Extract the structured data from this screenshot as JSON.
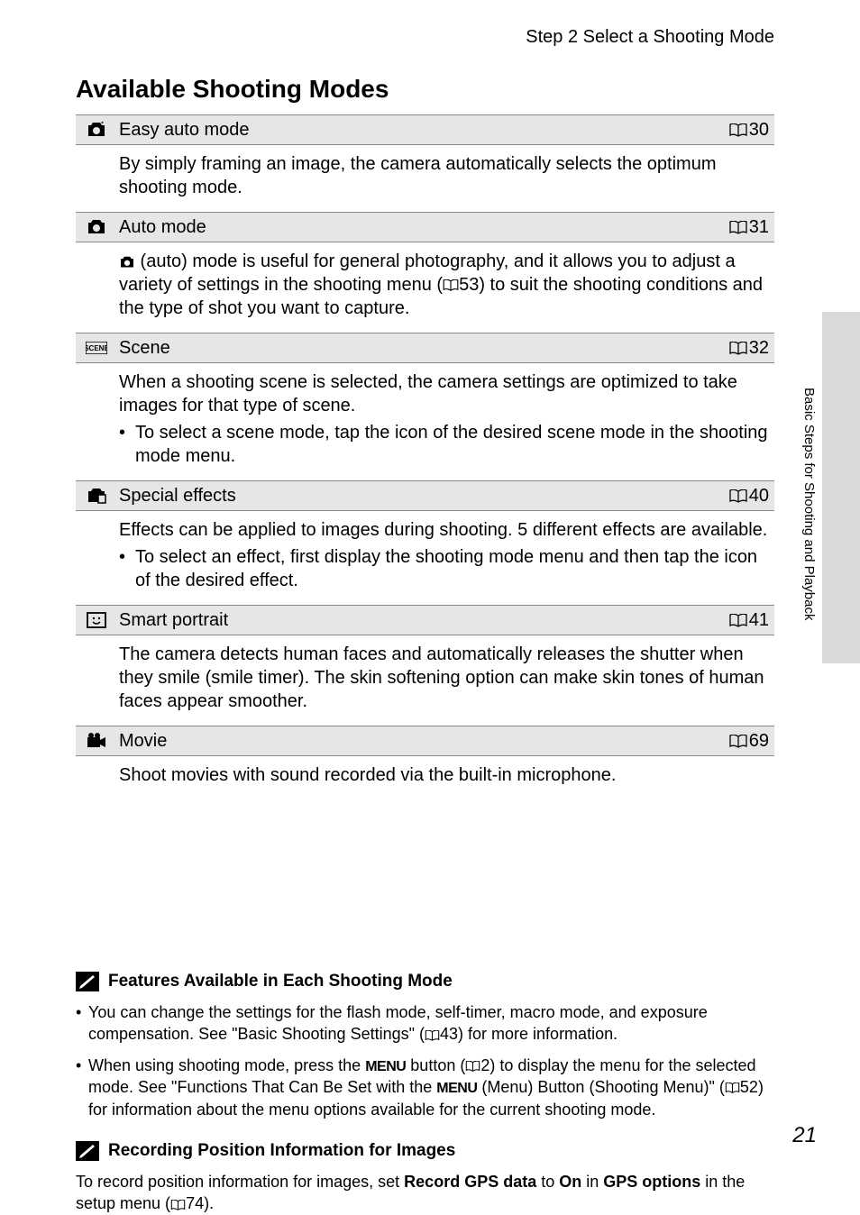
{
  "breadcrumb": "Step 2 Select a Shooting Mode",
  "title": "Available Shooting Modes",
  "modes": [
    {
      "label": "Easy auto mode",
      "page": "30",
      "desc": "By simply framing an image, the camera automatically selects the optimum shooting mode."
    },
    {
      "label": "Auto mode",
      "page": "31",
      "desc_pre": "",
      "desc": " (auto) mode is useful for general photography, and it allows you to adjust a variety of settings in the shooting menu (",
      "desc_ref": "53",
      "desc_post": ") to suit the shooting conditions and the type of shot you want to capture."
    },
    {
      "label": "Scene",
      "page": "32",
      "desc": "When a shooting scene is selected, the camera settings are optimized to take images for that type of scene.",
      "bullet": "To select a scene mode, tap the icon of the desired scene mode in the shooting mode menu."
    },
    {
      "label": "Special effects",
      "page": "40",
      "desc": "Effects can be applied to images during shooting. 5 different effects are available.",
      "bullet": "To select an effect, first display the shooting mode menu and then tap the icon of the desired effect."
    },
    {
      "label": "Smart portrait",
      "page": "41",
      "desc": "The camera detects human faces and automatically releases the shutter when they smile (smile timer). The skin softening option can make skin tones of human faces appear smoother."
    },
    {
      "label": "Movie",
      "page": "69",
      "desc": "Shoot movies with sound recorded via the built-in microphone."
    }
  ],
  "note1": {
    "title": "Features Available in Each Shooting Mode",
    "bullet1_a": "You can change the settings for the flash mode, self-timer, macro mode, and exposure compensation. See \"Basic Shooting Settings\" (",
    "bullet1_ref": "43",
    "bullet1_b": ") for more information.",
    "bullet2_a": "When using shooting mode, press the ",
    "bullet2_b": " button (",
    "bullet2_ref1": "2",
    "bullet2_c": ") to display the menu for the selected mode. See \"Functions That Can Be Set with the ",
    "bullet2_d": " (Menu) Button (Shooting Menu)\" (",
    "bullet2_ref2": "52",
    "bullet2_e": ") for information about the menu options available for the current shooting mode."
  },
  "note2": {
    "title": "Recording Position Information for Images",
    "body_a": "To record position information for images, set ",
    "body_b": "Record GPS data",
    "body_c": " to ",
    "body_d": "On",
    "body_e": " in ",
    "body_f": "GPS options",
    "body_g": " in the setup menu (",
    "body_ref": "74",
    "body_h": ")."
  },
  "side_text": "Basic Steps for Shooting and Playback",
  "page_number": "21",
  "menu_label": "MENU"
}
